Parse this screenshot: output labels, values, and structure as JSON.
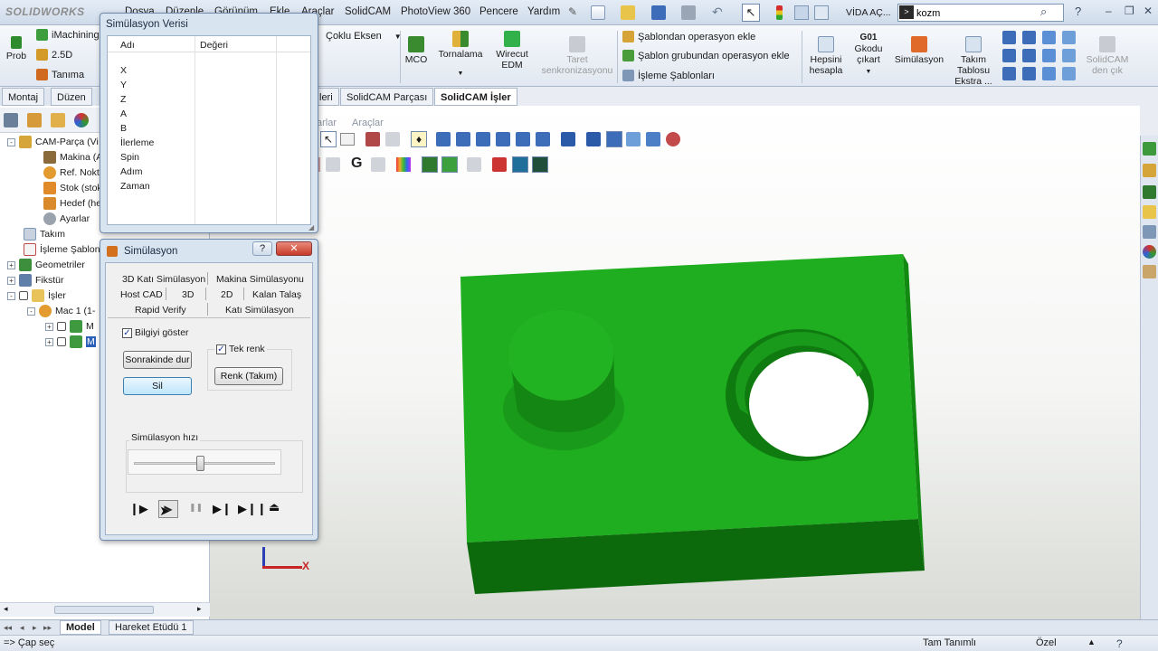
{
  "app": {
    "logo": "SOLIDWORKS",
    "menus": [
      "Dosya",
      "Düzenle",
      "Görünüm",
      "Ekle",
      "Araçlar",
      "SolidCAM",
      "PhotoView 360",
      "Pencere",
      "Yardım"
    ],
    "doc_title": "VİDA AÇ...",
    "search_value": "kozm",
    "search_prompt": ">"
  },
  "commands": {
    "left": [
      {
        "icon": "probe-icon",
        "label": "Prob"
      },
      {
        "icon": "imachining-icon",
        "label": "iMachining"
      },
      {
        "icon": "2d-icon",
        "label": "2.5D"
      },
      {
        "icon": "definition-icon",
        "label": "Tanıma"
      }
    ],
    "multiaxis_label": "Çoklu Eksen",
    "buttons": [
      {
        "label": "MCO"
      },
      {
        "label": "Tornalama"
      },
      {
        "label": "Wirecut EDM"
      },
      {
        "label": "Taret senkronizasyonu",
        "disabled": true
      }
    ],
    "template_ops": [
      "Şablondan operasyon ekle",
      "Şablon grubundan operasyon ekle",
      "İşleme Şablonları"
    ],
    "right_buttons": [
      {
        "label": "Hepsini hesapla"
      },
      {
        "label": "Gkodu çıkart",
        "badge": "G01"
      },
      {
        "label": "Simülasyon"
      },
      {
        "label": "Takım Tablosu Ekstra ..."
      },
      {
        "label": "SolidCAM den çık",
        "disabled": true
      }
    ]
  },
  "tabs": {
    "top_left": [
      "Montaj",
      "Düzen"
    ],
    "cam_tabs": [
      "leri",
      "SolidCAM Parçası",
      "SolidCAM İşler"
    ],
    "sub_tabs": [
      "arlar",
      "Araçlar"
    ]
  },
  "tree": {
    "items": [
      {
        "label": "CAM-Parça (Vi",
        "indent": 0,
        "icon": "cam-part-icon",
        "expander": "-"
      },
      {
        "label": "Makina (A",
        "indent": 1,
        "icon": "machine-icon"
      },
      {
        "label": "Ref. Nokt",
        "indent": 1,
        "icon": "reference-point-icon"
      },
      {
        "label": "Stok (stok",
        "indent": 1,
        "icon": "stock-icon"
      },
      {
        "label": "Hedef (he",
        "indent": 1,
        "icon": "target-icon"
      },
      {
        "label": "Ayarlar",
        "indent": 1,
        "icon": "settings-icon"
      },
      {
        "label": "Takım",
        "indent": 0,
        "icon": "tool-icon"
      },
      {
        "label": "İşleme Şablonl",
        "indent": 0,
        "icon": "machining-template-icon"
      },
      {
        "label": "Geometriler",
        "indent": 0,
        "icon": "geometry-icon",
        "expander": "+"
      },
      {
        "label": "Fikstür",
        "indent": 0,
        "icon": "fixture-icon",
        "expander": "+"
      },
      {
        "label": "İşler",
        "indent": 0,
        "icon": "operations-folder-icon",
        "expander": "-"
      },
      {
        "label": "Mac 1 (1-",
        "indent": 1,
        "icon": "setup-icon",
        "expander": "-"
      },
      {
        "label": "M",
        "indent": 2,
        "icon": "operation-icon",
        "expander": "+"
      },
      {
        "label": "M",
        "indent": 2,
        "icon": "operation-icon",
        "expander": "+",
        "selected": true
      }
    ]
  },
  "sim_data_dialog": {
    "title": "Simülasyon Verisi",
    "col_name": "Adı",
    "col_value": "Değeri",
    "rows": [
      "X",
      "Y",
      "Z",
      "A",
      "B",
      "İlerleme",
      "Spin",
      "Adım",
      "Zaman"
    ]
  },
  "sim_dialog": {
    "title": "Simülasyon",
    "help": "?",
    "close": "✕",
    "tabs_row1": [
      "3D Katı Simülasyon",
      "Makina Simülasyonu"
    ],
    "tabs_row2": [
      "Host CAD",
      "3D",
      "2D",
      "Kalan Talaş"
    ],
    "tabs_row3": [
      "Rapid Verify",
      "Katı Simülasyon"
    ],
    "show_info_label": "Bilgiyi göster",
    "show_info_checked": true,
    "stop_after_label": "Sonrakinde dur",
    "delete_label": "Sil",
    "single_color_label": "Tek renk",
    "single_color_checked": true,
    "color_tool_label": "Renk (Takım)",
    "speed_label": "Simülasyon hızı",
    "speed_level": 0.47,
    "controls": [
      "step-forward-icon",
      "play-icon",
      "pause-icon",
      "next-icon",
      "last-icon",
      "eject-icon"
    ]
  },
  "viewport": {
    "axis_x": "X",
    "part_color": "#1fa61f"
  },
  "bottom_tabs": [
    "Model",
    "Hareket Etüdü 1"
  ],
  "status": {
    "left": "=> Çap seç",
    "middle": "Tam Tanımlı",
    "right": "Özel"
  }
}
